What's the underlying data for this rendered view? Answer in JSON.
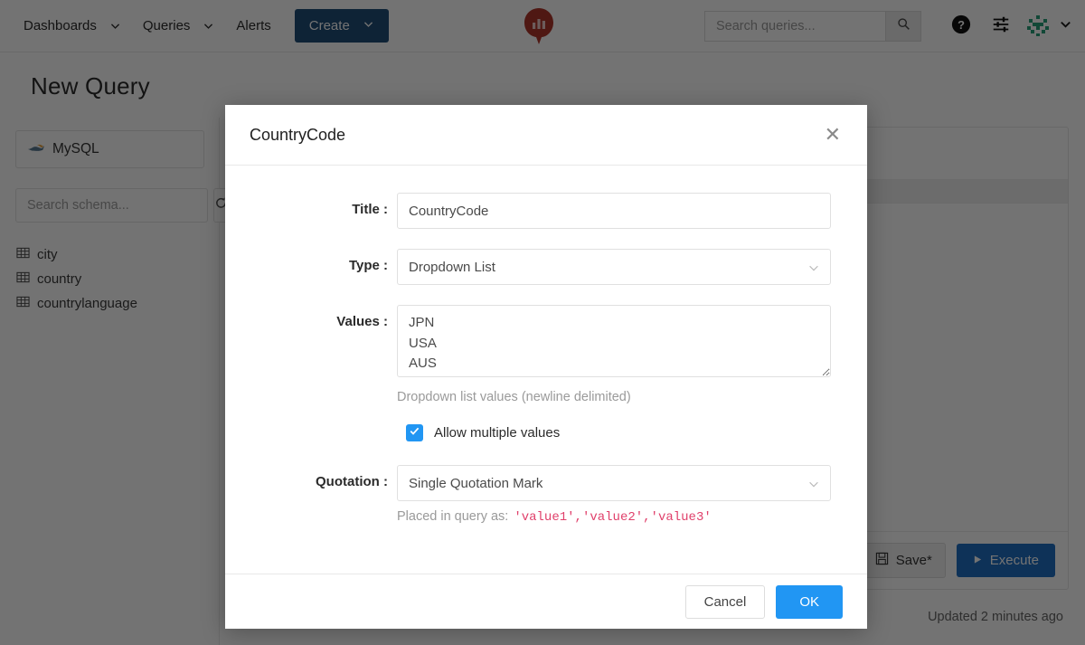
{
  "navbar": {
    "items": [
      {
        "label": "Dashboards",
        "caret": true,
        "name": "nav-dashboards"
      },
      {
        "label": "Queries",
        "caret": true,
        "name": "nav-queries"
      },
      {
        "label": "Alerts",
        "caret": false,
        "name": "nav-alerts"
      }
    ],
    "create_label": "Create",
    "logo_icon": "redash-logo-icon",
    "search_placeholder": "Search queries...",
    "search_value": "",
    "search_icon": "search-icon",
    "help_icon": "help-circle-icon",
    "settings_icon": "sliders-icon",
    "avatar_icon": "user-avatar-identicon",
    "avatar_caret_icon": "chevron-down-icon"
  },
  "page": {
    "title": "New Query"
  },
  "sidebar": {
    "datasource_label": "MySQL",
    "datasource_icon": "mysql-dolphin-icon",
    "search_placeholder": "Search schema...",
    "search_value": "",
    "refresh_icon": "refresh-icon",
    "tables": [
      {
        "label": "city",
        "icon": "table-grid-icon"
      },
      {
        "label": "country",
        "icon": "table-grid-icon"
      },
      {
        "label": "countrylanguage",
        "icon": "table-grid-icon"
      }
    ]
  },
  "editor": {
    "save_label": "Save*",
    "save_icon": "floppy-disk-icon",
    "execute_label": "Execute",
    "execute_icon": "play-triangle-icon",
    "updated_text": "Updated 2 minutes ago"
  },
  "modal": {
    "title": "CountryCode",
    "close_icon": "close-x-icon",
    "fields": {
      "title": {
        "label": "Title :",
        "value": "CountryCode"
      },
      "type": {
        "label": "Type :",
        "value": "Dropdown List",
        "caret_icon": "chevron-down-icon"
      },
      "values": {
        "label": "Values :",
        "value": "JPN\nUSA\nAUS",
        "help": "Dropdown list values (newline delimited)",
        "resize_icon": "resize-handle-icon"
      },
      "allow_multiple": {
        "label": "Allow multiple values",
        "checked": true,
        "check_icon": "checkmark-icon"
      },
      "quotation": {
        "label": "Quotation :",
        "value": "Single Quotation Mark",
        "caret_icon": "chevron-down-icon",
        "help_prefix": "Placed in query as:",
        "help_code": "'value1','value2','value3'"
      }
    },
    "cancel_label": "Cancel",
    "ok_label": "OK"
  },
  "colors": {
    "primary_blue": "#2196f3",
    "create_blue": "#1f4e79",
    "execute_blue": "#1f6fc4",
    "code_pink": "#e0406b",
    "logo_red": "#b0352c",
    "avatar_green": "#28a07a"
  }
}
